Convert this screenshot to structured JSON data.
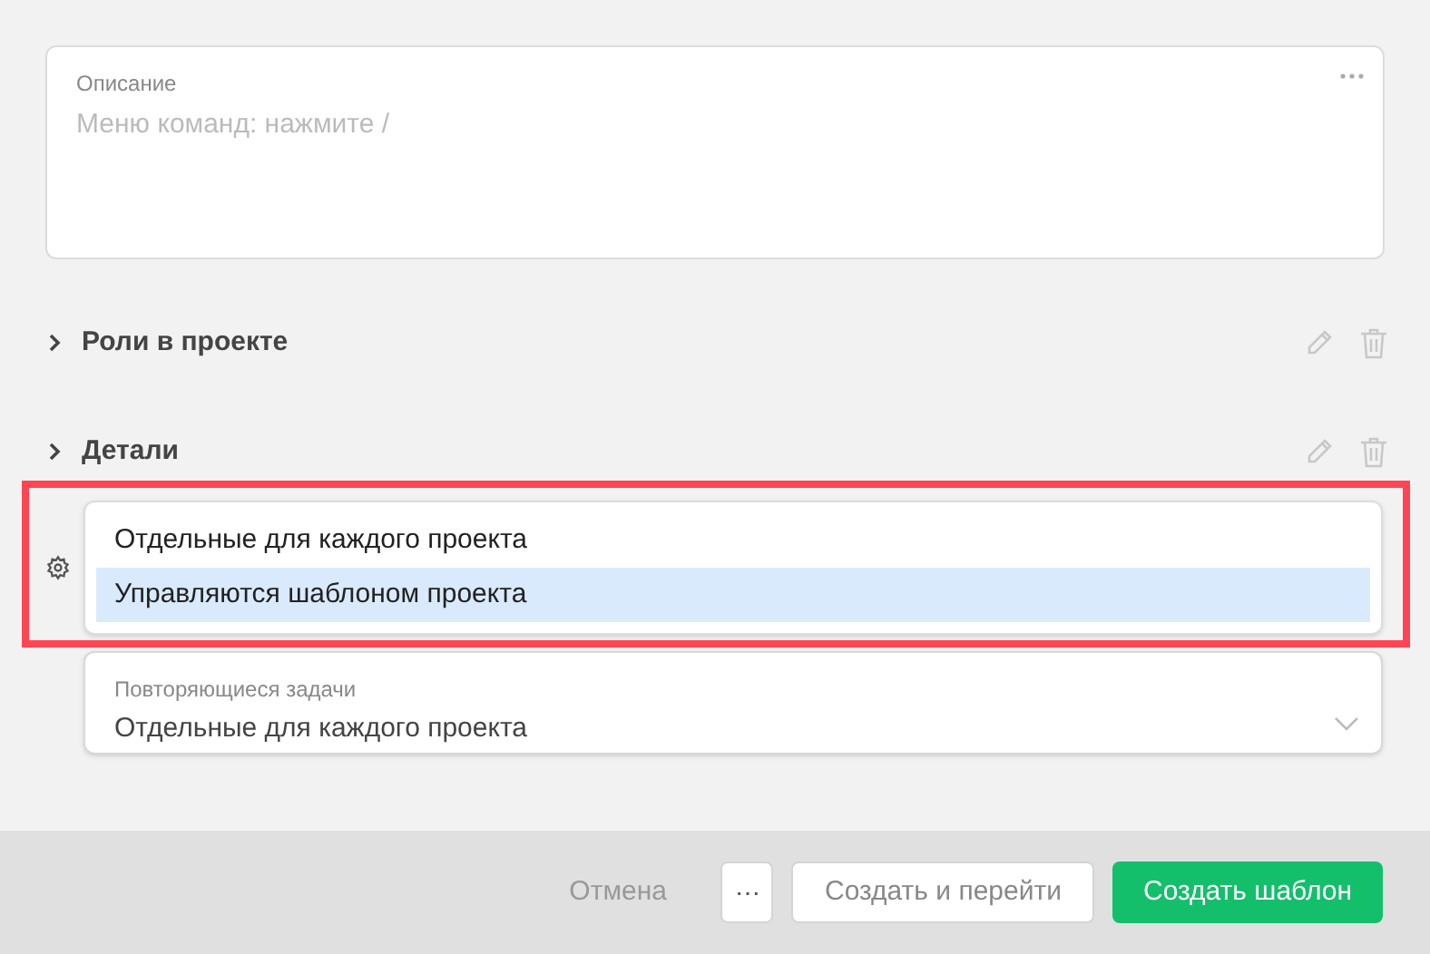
{
  "description": {
    "label": "Описание",
    "placeholder": "Меню команд: нажмите /"
  },
  "sections": [
    {
      "title": "Роли в проекте",
      "expanded": false
    },
    {
      "title": "Детали",
      "expanded": false
    }
  ],
  "dropdown": {
    "highlighted": true,
    "options": [
      {
        "label": "Отдельные для каждого проекта",
        "selected": false
      },
      {
        "label": "Управляются шаблоном проекта",
        "selected": true
      }
    ]
  },
  "field": {
    "label": "Повторяющиеся задачи",
    "value": "Отдельные для каждого проекта"
  },
  "footer": {
    "buttons": [
      {
        "label": "Отмена",
        "kind": "link"
      },
      {
        "label": "⋯",
        "kind": "more"
      },
      {
        "label": "Создать и перейти",
        "kind": "secondary"
      },
      {
        "label": "Создать шаблон",
        "kind": "primary"
      }
    ]
  }
}
